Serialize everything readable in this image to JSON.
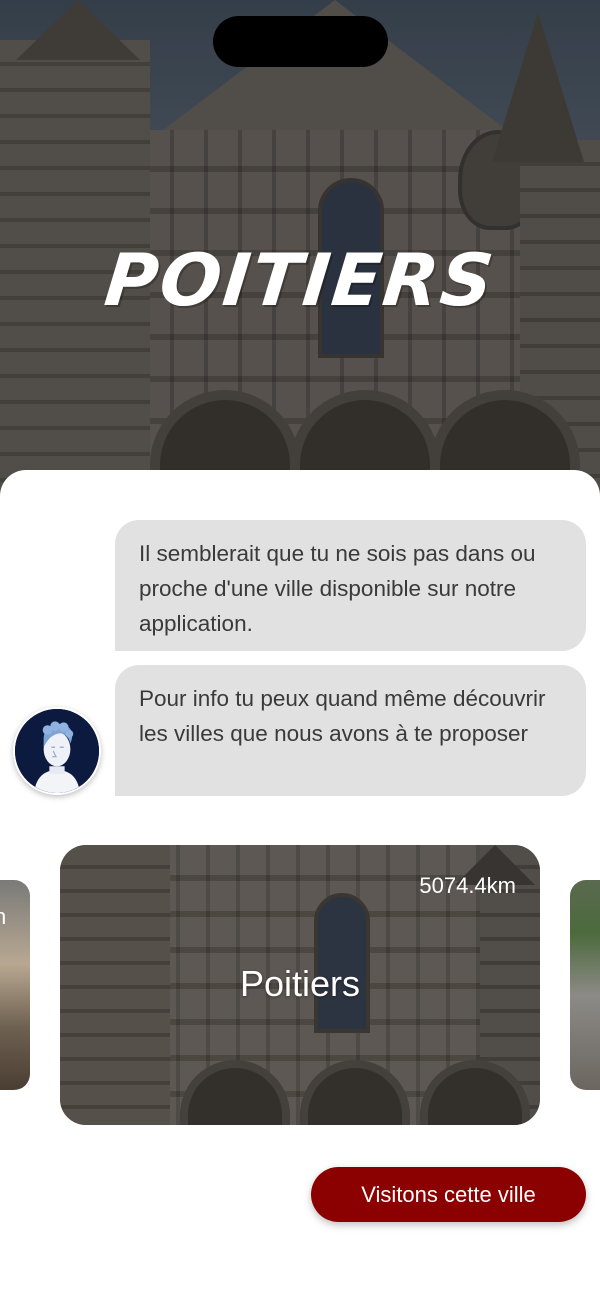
{
  "hero": {
    "title": "POITIERS",
    "image": "cathedral-facade"
  },
  "chat": {
    "messages": [
      "Il semblerait que tu ne sois pas dans ou proche d'une ville disponible sur notre application.",
      "Pour info tu peux quand même découvrir les villes que nous avons à te proposer"
    ],
    "avatar_icon": "statue-bust-icon"
  },
  "carousel": {
    "left_peek_text": "n",
    "cards": [
      {
        "city": "Poitiers",
        "distance": "5074.4km",
        "image": "cathedral-facade"
      }
    ]
  },
  "cta": {
    "label": "Visitons cette ville",
    "color": "#8b0000"
  },
  "colors": {
    "bubble": "#e2e1e2",
    "text": "#3a3a3a",
    "accent": "#8b0000"
  }
}
